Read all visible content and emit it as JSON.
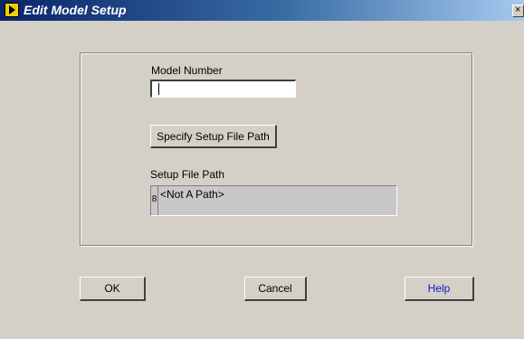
{
  "window": {
    "title": "Edit Model Setup",
    "close_glyph": "×"
  },
  "form": {
    "model_number_label": "Model Number",
    "model_number_value": "",
    "specify_button_label": "Specify Setup File Path",
    "setup_file_path_label": "Setup File Path",
    "setup_file_path_value": "<Not A Path>",
    "path_icon": "8"
  },
  "buttons": {
    "ok_label": "OK",
    "cancel_label": "Cancel",
    "help_label": "Help"
  },
  "colors": {
    "face": "#d4d0c8",
    "titlebar_start": "#0a246a",
    "help_text": "#1414c8"
  }
}
